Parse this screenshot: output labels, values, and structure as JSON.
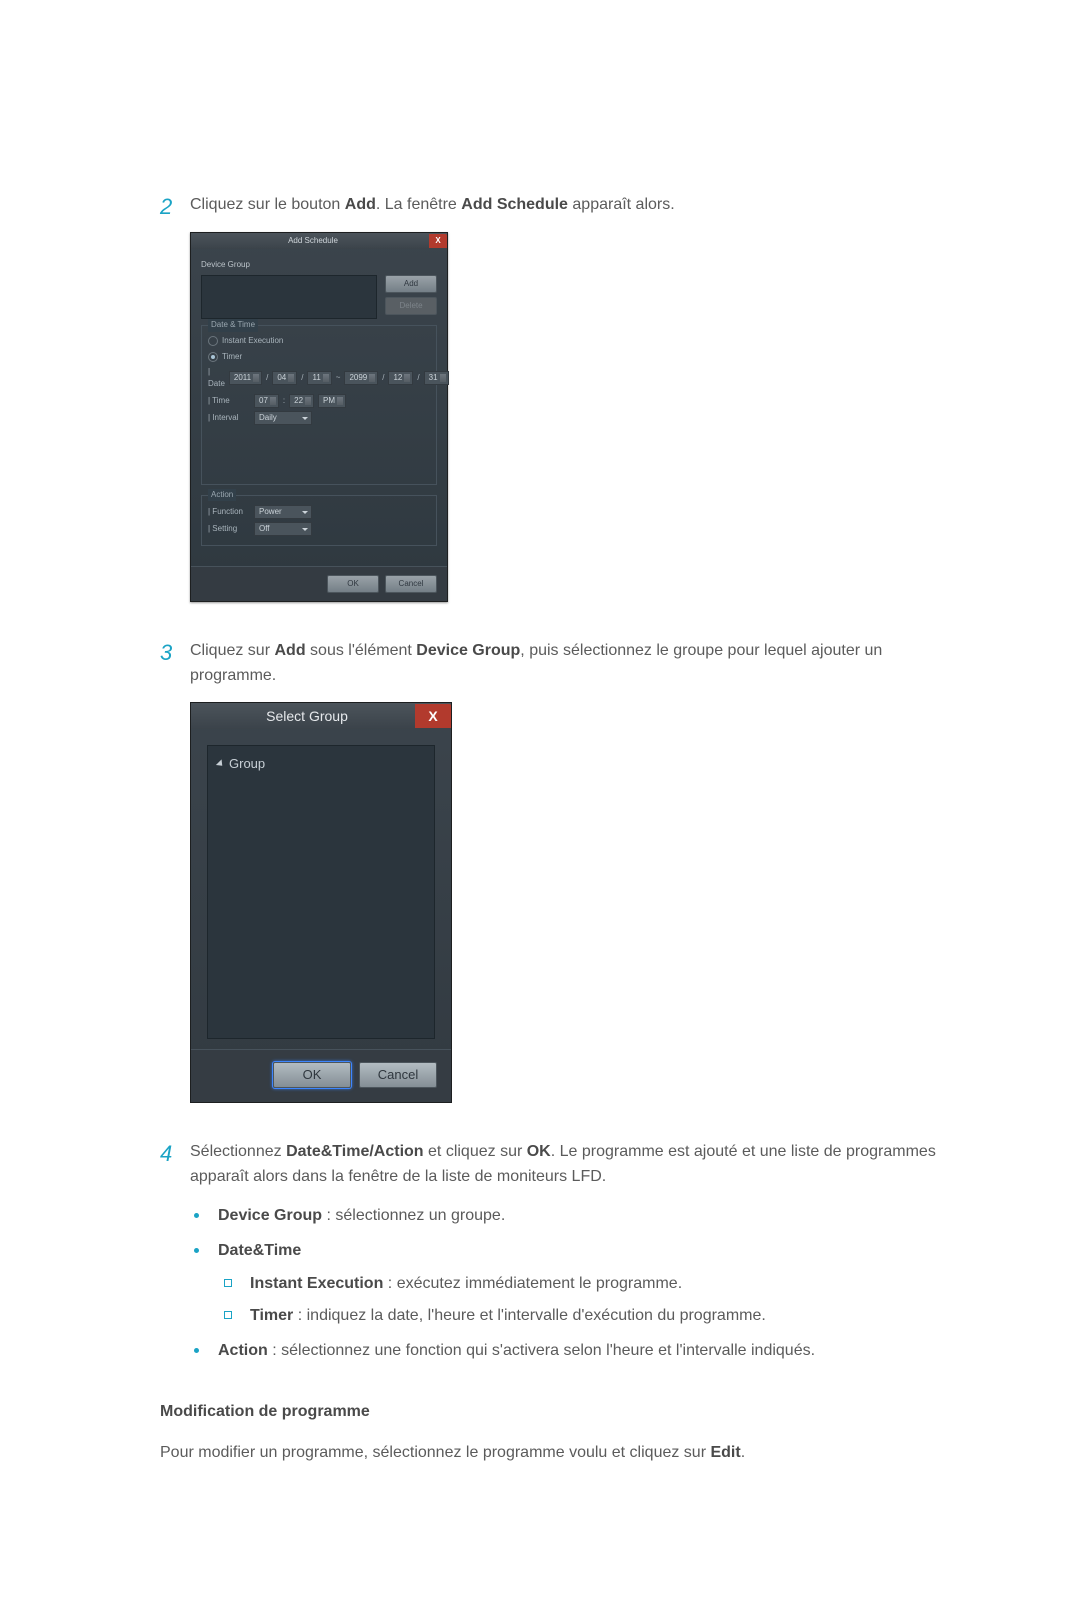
{
  "step2": {
    "number": "2",
    "line_a": "Cliquez sur le bouton ",
    "bold_a": "Add",
    "line_b": ". La fenêtre ",
    "bold_b": "Add Schedule",
    "line_c": " apparaît alors."
  },
  "add_schedule": {
    "title": "Add Schedule",
    "device_group_label": "Device Group",
    "add_btn": "Add",
    "delete_btn": "Delete",
    "datetime_label": "Date & Time",
    "instant_label": "Instant Execution",
    "timer_label": "Timer",
    "date_lbl": "| Date",
    "date_y1": "2011",
    "date_m1": "04",
    "date_d1": "11",
    "date_tilde": "~",
    "date_y2": "2099",
    "date_m2": "12",
    "date_d2": "31",
    "time_lbl": "| Time",
    "time_h": "07",
    "time_m": "22",
    "time_ampm": "PM",
    "interval_lbl": "| Interval",
    "interval_val": "Daily",
    "action_label": "Action",
    "func_lbl": "| Function",
    "func_val": "Power",
    "setting_lbl": "| Setting",
    "setting_val": "Off",
    "ok_btn": "OK",
    "cancel_btn": "Cancel"
  },
  "step3": {
    "number": "3",
    "line_a": "Cliquez sur ",
    "bold_a": "Add",
    "line_b": " sous l'élément ",
    "bold_b": "Device Group",
    "line_c": ", puis sélectionnez le groupe pour lequel ajouter un programme."
  },
  "select_group": {
    "title": "Select Group",
    "root_label": "Group",
    "ok_btn": "OK",
    "cancel_btn": "Cancel"
  },
  "step4": {
    "number": "4",
    "line_a": "Sélectionnez ",
    "bold_a": "Date&Time/Action",
    "line_b": " et cliquez sur ",
    "bold_b": "OK",
    "line_c": ". Le programme est ajouté et une liste de programmes apparaît alors dans la fenêtre de la liste de moniteurs LFD.",
    "b_device_group": "Device Group",
    "b_device_group_after": " : sélectionnez un groupe.",
    "b_datetime": "Date&Time",
    "sub_instant_b": "Instant Execution",
    "sub_instant_after": " : exécutez immédiatement le programme.",
    "sub_timer_b": "Timer",
    "sub_timer_after": " : indiquez la date, l'heure et l'intervalle d'exécution du programme.",
    "b_action": "Action",
    "b_action_after": " : sélectionnez une fonction qui s'activera selon l'heure et l'intervalle indiqués."
  },
  "modif": {
    "heading": "Modification de programme",
    "para_a": "Pour modifier un programme, sélectionnez le programme voulu et cliquez sur ",
    "bold": "Edit",
    "para_b": "."
  }
}
